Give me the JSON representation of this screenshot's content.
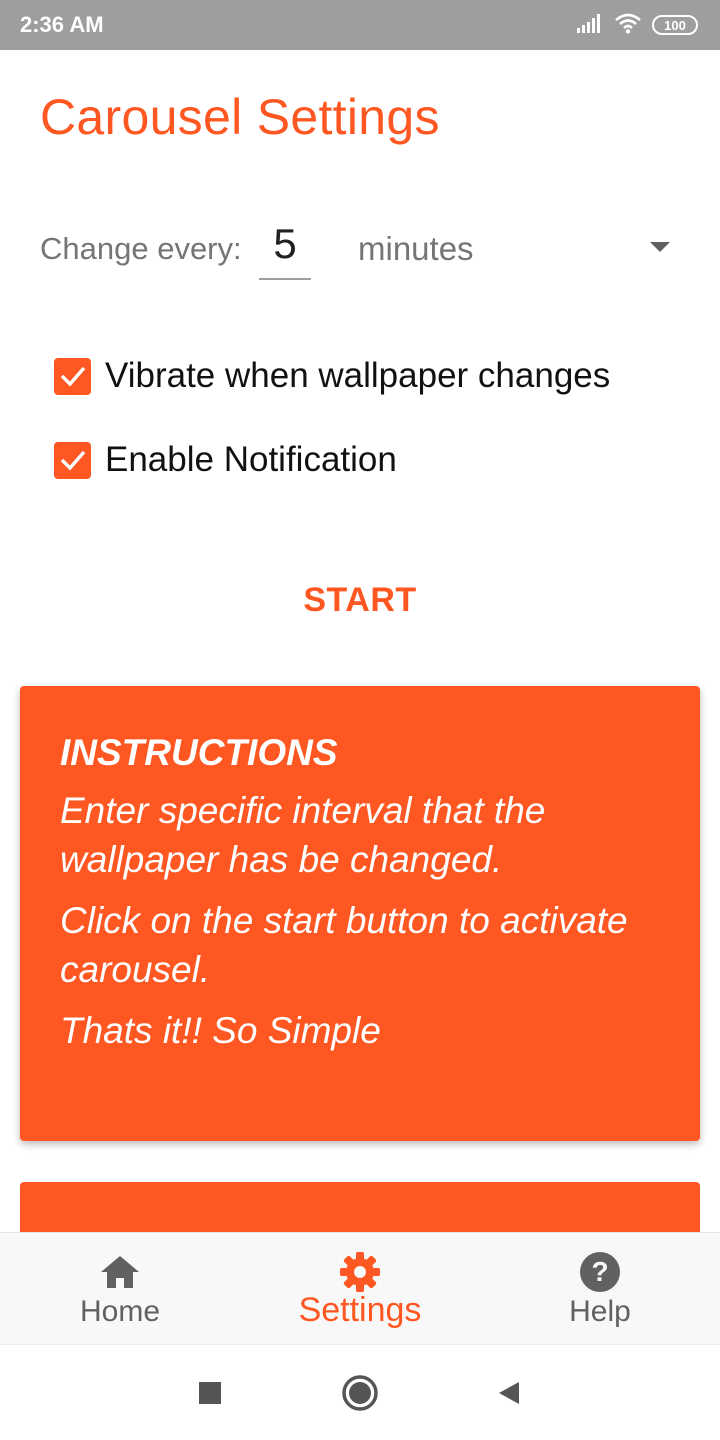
{
  "status_bar": {
    "time": "2:36 AM",
    "battery": "100",
    "icons": [
      "signal-icon",
      "wifi-icon",
      "battery-icon"
    ]
  },
  "page": {
    "title": "Carousel Settings"
  },
  "interval": {
    "label": "Change every:",
    "value": "5",
    "unit": "minutes"
  },
  "options": [
    {
      "label": "Vibrate when wallpaper changes",
      "checked": true
    },
    {
      "label": "Enable Notification",
      "checked": true
    }
  ],
  "start_button": {
    "label": "START"
  },
  "instructions": {
    "title": "INSTRUCTIONS",
    "paragraphs": [
      "Enter specific interval that the wallpaper has be changed.",
      "Click on the start button to activate carousel.",
      "Thats it!! So Simple"
    ]
  },
  "bottom_nav": {
    "items": [
      {
        "label": "Home",
        "icon": "home-icon",
        "active": false
      },
      {
        "label": "Settings",
        "icon": "gear-icon",
        "active": true
      },
      {
        "label": "Help",
        "icon": "help-icon",
        "active": false
      }
    ]
  },
  "system_nav": {
    "buttons": [
      "recents-icon",
      "home-circle-icon",
      "back-icon"
    ]
  },
  "colors": {
    "accent": "#FF5722",
    "status_bar": "#9E9E9E",
    "nav_inactive": "#616161"
  }
}
